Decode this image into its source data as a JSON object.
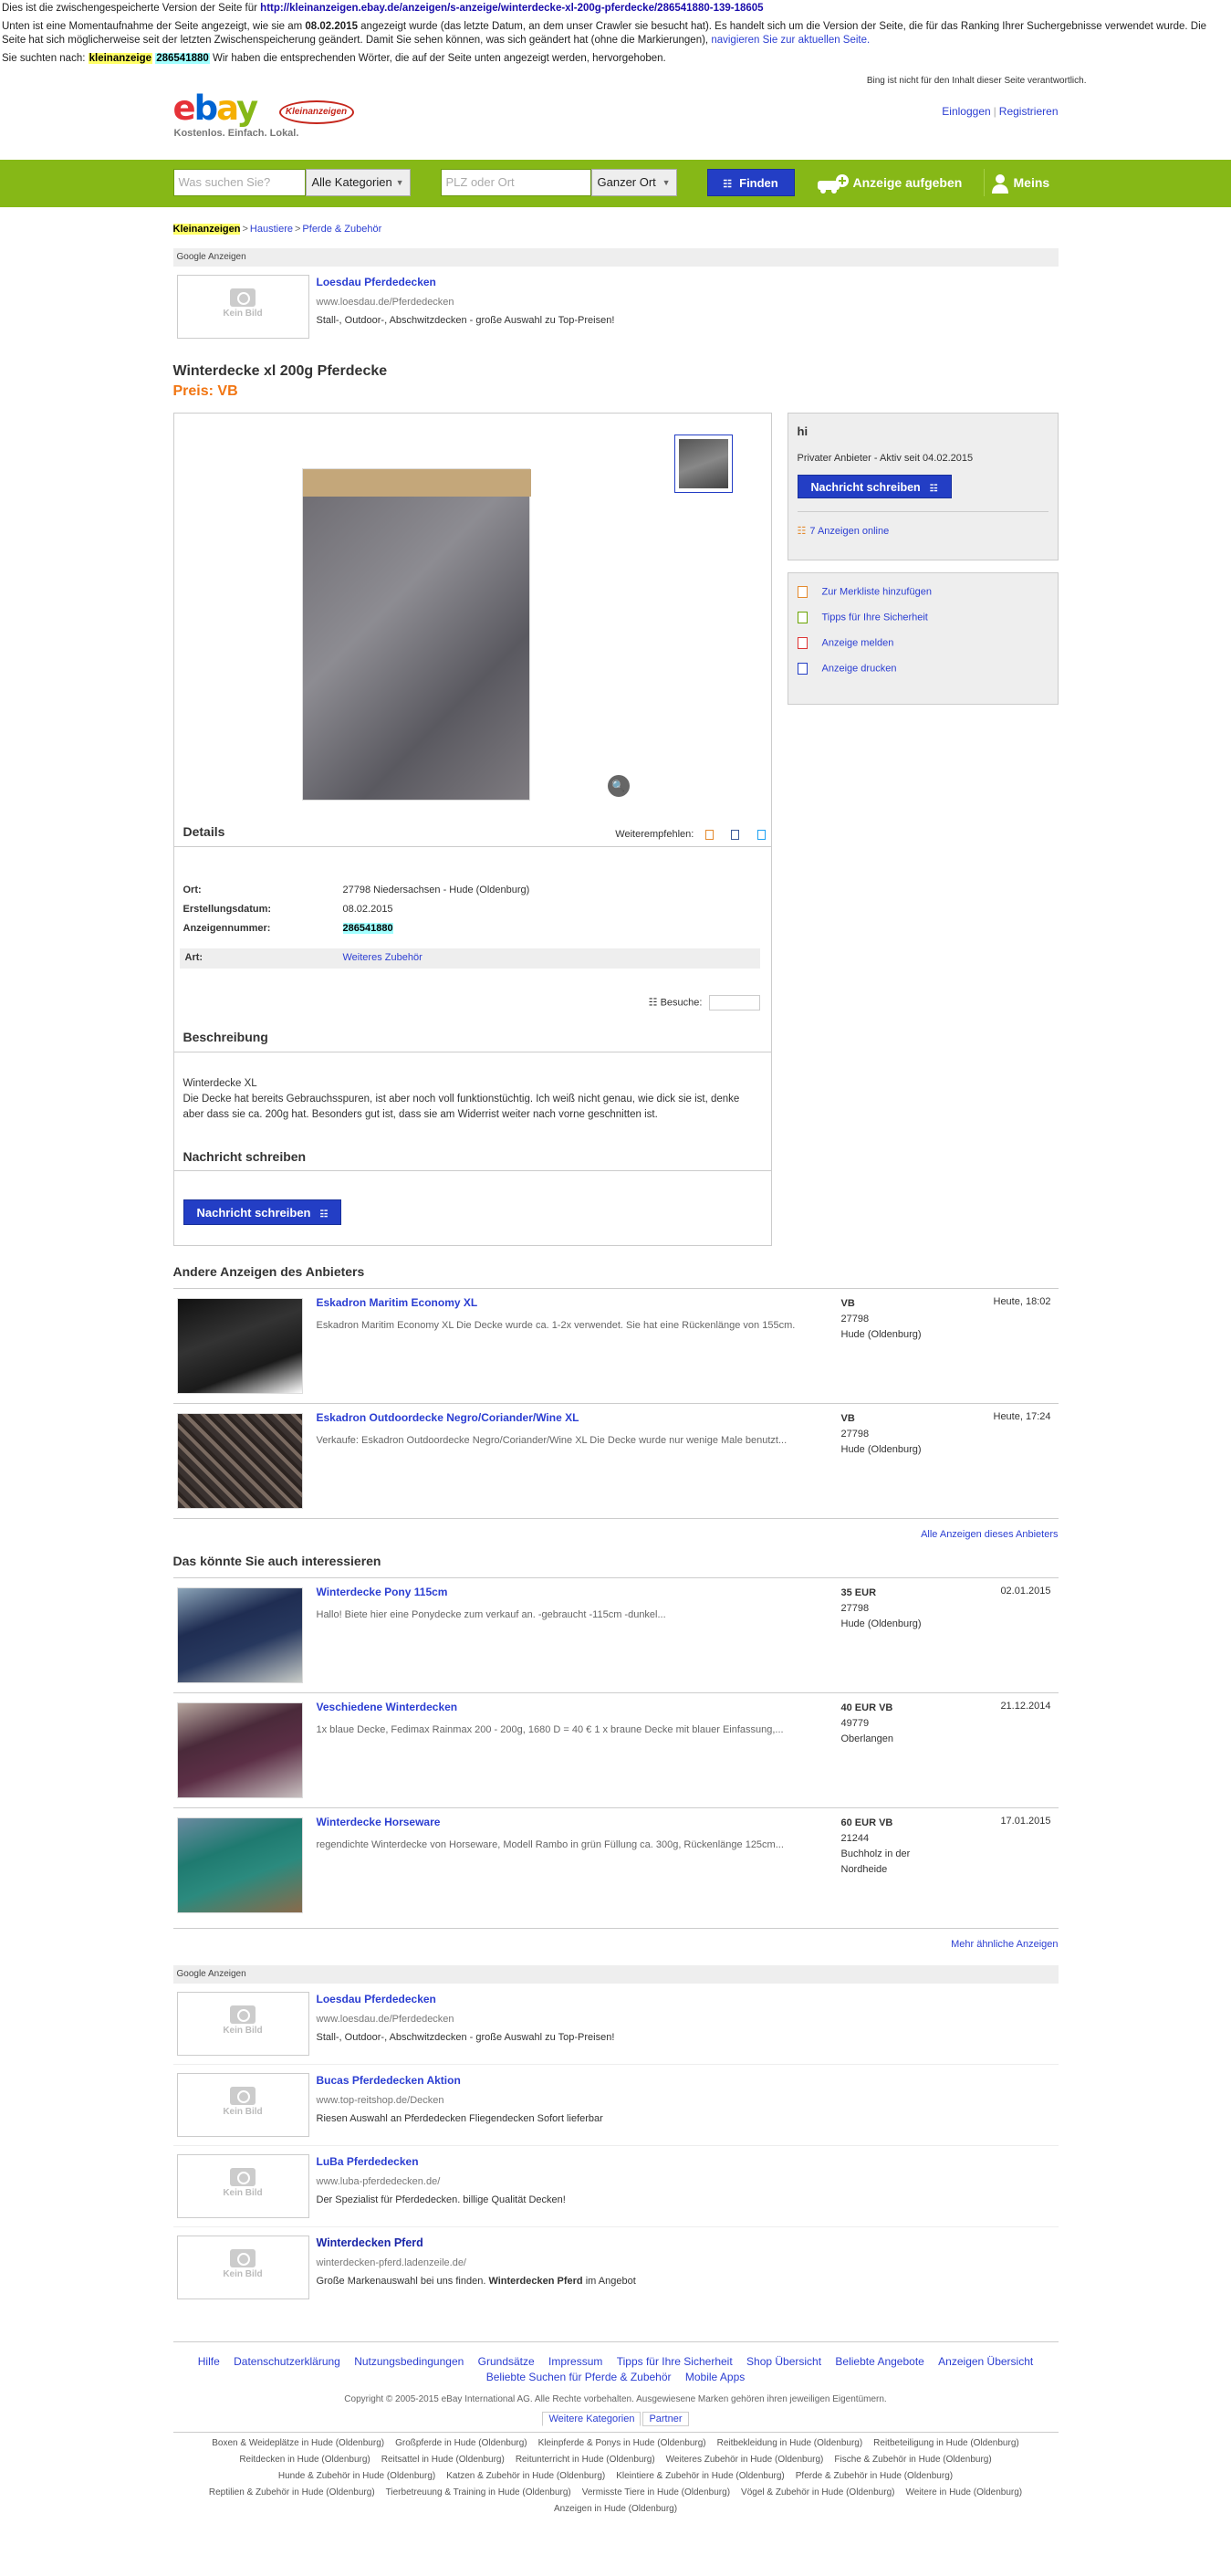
{
  "cache": {
    "line1_prefix": "Dies ist die zwischengespeicherte Version der Seite für ",
    "line1_url": "http://kleinanzeigen.ebay.de/anzeigen/s-anzeige/winterdecke-xl-200g-pferdecke/286541880-139-18605",
    "line2_a": "Unten ist eine Momentaufnahme der Seite angezeigt, wie sie am ",
    "line2_date": "08.02.2015",
    "line2_b": " angezeigt wurde (das letzte Datum, an dem unser Crawler sie besucht hat). Es handelt sich um die Version der Seite, die für das Ranking Ihrer Suchergebnisse verwendet wurde. Die Seite hat sich möglicherweise seit der letzten Zwischenspeicherung geändert. Damit Sie sehen können, was sich geändert hat (ohne die Markierungen), ",
    "line2_link": "navigieren Sie zur aktuellen Seite.",
    "line3_a": "Sie suchten nach: ",
    "line3_kw1": "kleinanzeige",
    "line3_kw2": "286541880",
    "line3_b": " Wir haben die entsprechenden Wörter, die auf der Seite unten angezeigt werden, hervorgehoben.",
    "bing_note": "Bing ist nicht für den Inhalt dieser Seite verantwortlich."
  },
  "header": {
    "logo_letters": [
      "e",
      "b",
      "a",
      "y"
    ],
    "logo_badge": "Kleinanzeigen",
    "logo_tagline": "Kostenlos. Einfach. Lokal.",
    "login": "Einloggen",
    "sep": "|",
    "register": "Registrieren"
  },
  "search": {
    "query_placeholder": "Was suchen Sie?",
    "category": "Alle Kategorien",
    "location_placeholder": "PLZ oder Ort",
    "radius": "Ganzer Ort",
    "find": "Finden",
    "post_ad": "Anzeige aufgeben",
    "mine": "Meins"
  },
  "breadcrumb": {
    "items": [
      "Kleinanzeigen",
      "Haustiere",
      "Pferde & Zubehör"
    ],
    "sep": ">"
  },
  "google_label": "Google Anzeigen",
  "no_image": "Kein Bild",
  "top_ad": {
    "title": "Loesdau Pferdedecken",
    "url": "www.loesdau.de/Pferdedecken",
    "text": "Stall-, Outdoor-, Abschwitzdecken - große Auswahl zu Top-Preisen!"
  },
  "ad": {
    "title": "Winterdecke xl 200g Pferdecke",
    "price": "Preis: VB",
    "details_heading": "Details",
    "recommend": "Weiterempfehlen:",
    "fields": [
      {
        "label": "Ort:",
        "value": "27798 Niedersachsen - Hude (Oldenburg)"
      },
      {
        "label": "Erstellungsdatum:",
        "value": "08.02.2015"
      },
      {
        "label": "Anzeigennummer:",
        "value": "286541880"
      }
    ],
    "art_label": "Art:",
    "art_value": "Weiteres Zubehör",
    "visits_label": "Besuche:",
    "desc_heading": "Beschreibung",
    "desc_line1": "Winterdecke XL",
    "desc_line2": "Die Decke hat bereits Gebrauchsspuren, ist aber noch voll funktionstüchtig. Ich weiß nicht genau, wie dick sie ist, denke aber dass sie ca. 200g hat. Besonders gut ist, dass sie am Widerrist weiter nach vorne geschnitten ist.",
    "message_heading": "Nachricht schreiben",
    "message_button": "Nachricht schreiben"
  },
  "seller": {
    "name": "hi",
    "info": "Privater Anbieter - Aktiv seit 04.02.2015",
    "button": "Nachricht schreiben",
    "ads_online": "7 Anzeigen online"
  },
  "actions": [
    "Zur Merkliste hinzufügen",
    "Tipps für Ihre Sicherheit",
    "Anzeige melden",
    "Anzeige drucken"
  ],
  "other_ads": {
    "heading": "Andere Anzeigen des Anbieters",
    "items": [
      {
        "title": "Eskadron Maritim Economy XL",
        "desc": "Eskadron Maritim Economy XL Die Decke wurde ca. 1-2x verwendet. Sie hat eine Rückenlänge von 155cm.",
        "price": "VB",
        "zip": "27798",
        "city": "Hude (Oldenburg)",
        "date": "Heute, 18:02"
      },
      {
        "title": "Eskadron Outdoordecke Negro/Coriander/Wine XL",
        "desc": "Verkaufe: Eskadron Outdoordecke Negro/Coriander/Wine XL Die Decke wurde nur wenige Male benutzt...",
        "price": "VB",
        "zip": "27798",
        "city": "Hude (Oldenburg)",
        "date": "Heute, 17:24"
      }
    ],
    "all_link": "Alle Anzeigen dieses Anbieters"
  },
  "similar": {
    "heading": "Das könnte Sie auch interessieren",
    "items": [
      {
        "title": "Winterdecke Pony 115cm",
        "desc": "Hallo! Biete hier eine Ponydecke zum verkauf an. -gebraucht -115cm -dunkel...",
        "price": "35 EUR",
        "zip": "27798",
        "city": "Hude (Oldenburg)",
        "date": "02.01.2015"
      },
      {
        "title": "Veschiedene Winterdecken",
        "desc": "1x blaue Decke, Fedimax Rainmax 200 - 200g, 1680 D = 40 € 1 x braune Decke mit blauer Einfassung,...",
        "price": "40 EUR VB",
        "zip": "49779",
        "city": "Oberlangen",
        "date": "21.12.2014"
      },
      {
        "title": "Winterdecke Horseware",
        "desc": "regendichte Winterdecke von Horseware, Modell Rambo in grün Füllung ca. 300g, Rückenlänge 125cm...",
        "price": "60 EUR VB",
        "zip": "21244",
        "city": "Buchholz in der Nordheide",
        "date": "17.01.2015"
      }
    ],
    "more_link": "Mehr ähnliche Anzeigen"
  },
  "bottom_ads": [
    {
      "title": "Loesdau Pferdedecken",
      "url": "www.loesdau.de/Pferdedecken",
      "text": "Stall-, Outdoor-, Abschwitzdecken - große Auswahl zu Top-Preisen!"
    },
    {
      "title": "Bucas Pferdedecken Aktion",
      "url": "www.top-reitshop.de/Decken",
      "text": "Riesen Auswahl an Pferdedecken Fliegendecken Sofort lieferbar"
    },
    {
      "title": "LuBa Pferdedecken",
      "url": "www.luba-pferdedecken.de/",
      "text": "Der Spezialist für Pferdedecken. billige Qualität Decken!"
    },
    {
      "title": "Winterdecken Pferd",
      "url": "winterdecken-pferd.ladenzeile.de/",
      "text_a": "Große Markenauswahl bei uns finden. ",
      "text_b": "Winterdecken Pferd",
      "text_c": " im Angebot"
    }
  ],
  "footer": {
    "links": [
      "Hilfe",
      "Datenschutzerklärung",
      "Nutzungsbedingungen",
      "Grundsätze",
      "Impressum",
      "Tipps für Ihre Sicherheit",
      "Shop Übersicht",
      "Beliebte Angebote",
      "Anzeigen Übersicht"
    ],
    "links2": [
      "Beliebte Suchen für Pferde & Zubehör",
      "Mobile Apps"
    ],
    "copyright": "Copyright © 2005-2015 eBay International AG. Alle Rechte vorbehalten. Ausgewiesene Marken gehören ihren jeweiligen Eigentümern.",
    "tabs": [
      "Weitere Kategorien",
      "Partner"
    ],
    "seo": [
      "Boxen & Weideplätze in Hude (Oldenburg)",
      "Großpferde in Hude (Oldenburg)",
      "Kleinpferde & Ponys in Hude (Oldenburg)",
      "Reitbekleidung in Hude (Oldenburg)",
      "Reitbeteiligung in Hude (Oldenburg)",
      "Reitdecken in Hude (Oldenburg)",
      "Reitsattel in Hude (Oldenburg)",
      "Reitunterricht in Hude (Oldenburg)",
      "Weiteres Zubehör in Hude (Oldenburg)",
      "Fische & Zubehör in Hude (Oldenburg)",
      "Hunde & Zubehör in Hude (Oldenburg)",
      "Katzen & Zubehör in Hude (Oldenburg)",
      "Kleintiere & Zubehör in Hude (Oldenburg)",
      "Pferde & Zubehör in Hude (Oldenburg)",
      "Reptilien & Zubehör in Hude (Oldenburg)",
      "Tierbetreuung & Training in Hude (Oldenburg)",
      "Vermisste Tiere in Hude (Oldenburg)",
      "Vögel & Zubehör in Hude (Oldenburg)",
      "Weitere in Hude (Oldenburg)",
      "Anzeigen in Hude (Oldenburg)"
    ]
  },
  "colors": {
    "green": "#86b817",
    "blue": "#233ec5",
    "orange": "#f17512",
    "link": "#2b3ed2"
  }
}
